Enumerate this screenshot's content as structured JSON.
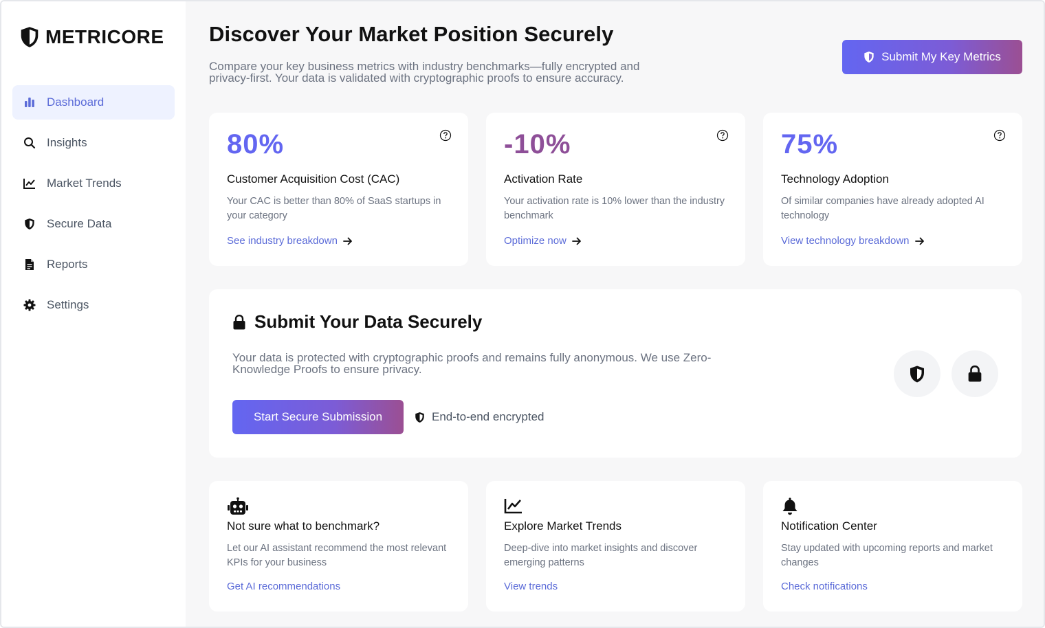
{
  "brand": {
    "name": "METRICORE",
    "icon": "shield-icon"
  },
  "sidebar": {
    "items": [
      {
        "label": "Dashboard",
        "icon": "bar-chart-icon",
        "active": true
      },
      {
        "label": "Insights",
        "icon": "search-icon"
      },
      {
        "label": "Market Trends",
        "icon": "line-chart-icon"
      },
      {
        "label": "Secure Data",
        "icon": "shield-icon"
      },
      {
        "label": "Reports",
        "icon": "document-icon"
      },
      {
        "label": "Settings",
        "icon": "gear-icon"
      }
    ]
  },
  "header": {
    "title": "Discover Your Market Position Securely",
    "subtitle": "Compare your key business metrics with industry benchmarks—fully encrypted and privacy-first. Your data is validated with cryptographic proofs to ensure accuracy.",
    "submit_button": "Submit My Key Metrics"
  },
  "stats": [
    {
      "value": "80%",
      "title": "Customer Acquisition Cost (CAC)",
      "desc": "Your CAC is better than 80% of SaaS startups in your category",
      "link": "See industry breakdown",
      "color": "#6366f1"
    },
    {
      "value": "-10%",
      "title": "Activation Rate",
      "desc": "Your activation rate is 10% lower than the industry benchmark",
      "link": "Optimize now",
      "color": "#8e4f98"
    },
    {
      "value": "75%",
      "title": "Technology Adoption",
      "desc": "Of similar companies have already adopted AI technology",
      "link": "View technology breakdown",
      "color": "#6366f1"
    }
  ],
  "secure": {
    "title": "Submit Your Data Securely",
    "desc": "Your data is protected with cryptographic proofs and remains fully anonymous. We use Zero-Knowledge Proofs to ensure privacy.",
    "button": "Start Secure Submission",
    "badge": "End-to-end encrypted"
  },
  "features": [
    {
      "icon": "robot-icon",
      "title": "Not sure what to benchmark?",
      "desc": "Let our AI assistant recommend the most relevant KPIs for your business",
      "link": "Get AI recommendations"
    },
    {
      "icon": "line-chart-icon",
      "title": "Explore Market Trends",
      "desc": "Deep-dive into market insights and discover emerging patterns",
      "link": "View trends"
    },
    {
      "icon": "bell-icon",
      "title": "Notification Center",
      "desc": "Stay updated with upcoming reports and market changes",
      "link": "Check notifications"
    }
  ],
  "colors": {
    "accent": "#5b6bd8",
    "gradient_start": "#6366f1",
    "gradient_end": "#9b4f93"
  }
}
